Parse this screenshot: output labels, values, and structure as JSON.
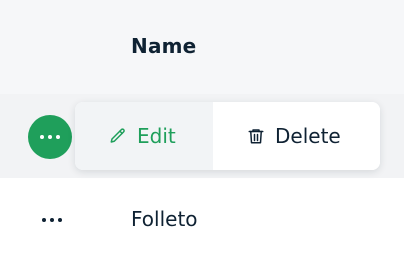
{
  "table": {
    "header": {
      "name_label": "Name"
    },
    "rows": [
      {
        "name": ""
      },
      {
        "name": "Folleto"
      }
    ]
  },
  "row_menu": {
    "edit_label": "Edit",
    "delete_label": "Delete",
    "edit_icon": "pencil-icon",
    "delete_icon": "trash-icon"
  },
  "row_actions": {
    "icon": "more-horizontal-icon"
  },
  "colors": {
    "accent": "#1f9f5b",
    "text": "#0f2233",
    "header_bg": "#f6f7f9",
    "active_row_bg": "#f2f3f5",
    "menu_bg": "#ffffff"
  }
}
